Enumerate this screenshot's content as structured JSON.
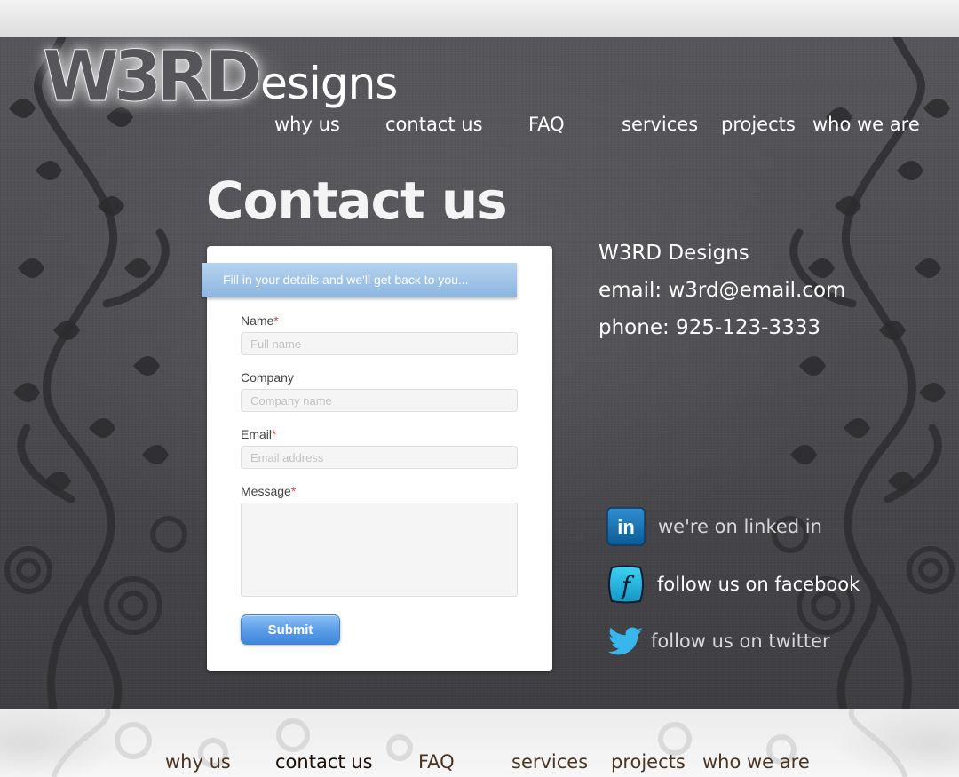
{
  "logo": {
    "big": "W3RD",
    "small": "esigns"
  },
  "nav": [
    "why us",
    "contact us",
    "FAQ",
    "services",
    "projects",
    "who we are"
  ],
  "page_title": "Contact us",
  "form": {
    "banner": "Fill in your details and we'll get back to you...",
    "name_label": "Name",
    "name_placeholder": "Full name",
    "company_label": "Company",
    "company_placeholder": "Company name",
    "email_label": "Email",
    "email_placeholder": "Email address",
    "message_label": "Message",
    "required_mark": "*",
    "submit": "Submit"
  },
  "contact": {
    "company": "W3RD Designs",
    "email": "email: w3rd@email.com",
    "phone": "phone: 925-123-3333"
  },
  "social": {
    "linkedin": "we're on linked in",
    "linkedin_icon_text": "in",
    "facebook": "follow us on facebook",
    "facebook_icon_text": "f",
    "twitter": "follow us on twitter"
  },
  "colors": {
    "background": "#4e4e52",
    "form_banner": "#9fc3e8",
    "submit": "#4f93e2",
    "footer_link": "#4a3422"
  }
}
